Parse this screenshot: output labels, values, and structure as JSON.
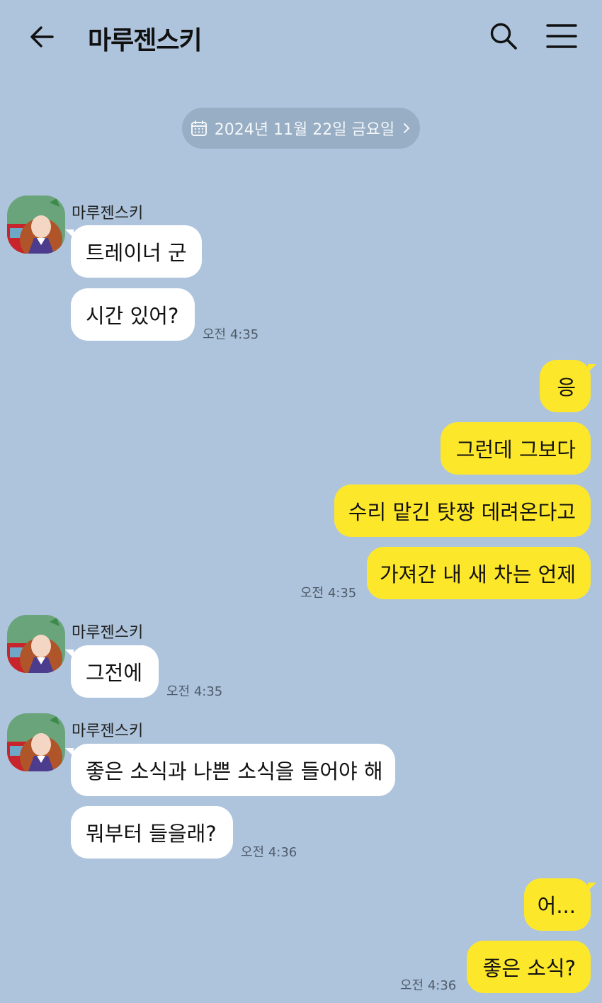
{
  "header": {
    "title": "마루젠스키",
    "back_icon": "arrow-left-icon",
    "search_icon": "search-icon",
    "menu_icon": "hamburger-menu-icon"
  },
  "date_divider": {
    "icon": "calendar-icon",
    "label": "2024년 11월 22일 금요일",
    "chevron_icon": "chevron-right-icon"
  },
  "colors": {
    "background": "#aec4dc",
    "incoming_bubble": "#ffffff",
    "outgoing_bubble": "#fde72b",
    "date_pill": "#98aec4"
  },
  "messages": [
    {
      "direction": "in",
      "sender": "마루젠스키",
      "texts": [
        "트레이너 군",
        "시간 있어?"
      ],
      "time": "오전 4:35"
    },
    {
      "direction": "out",
      "texts": [
        "응",
        "그런데 그보다",
        "수리 맡긴 탓짱 데려온다고",
        "가져간 내 새 차는 언제"
      ],
      "time": "오전 4:35"
    },
    {
      "direction": "in",
      "sender": "마루젠스키",
      "texts": [
        "그전에"
      ],
      "time": "오전 4:35"
    },
    {
      "direction": "in",
      "sender": "마루젠스키",
      "texts": [
        "좋은 소식과 나쁜 소식을 들어야 해",
        "뭐부터 들을래?"
      ],
      "time": "오전 4:36"
    },
    {
      "direction": "out",
      "texts": [
        "어...",
        "좋은 소식?"
      ],
      "time": "오전 4:36"
    }
  ]
}
